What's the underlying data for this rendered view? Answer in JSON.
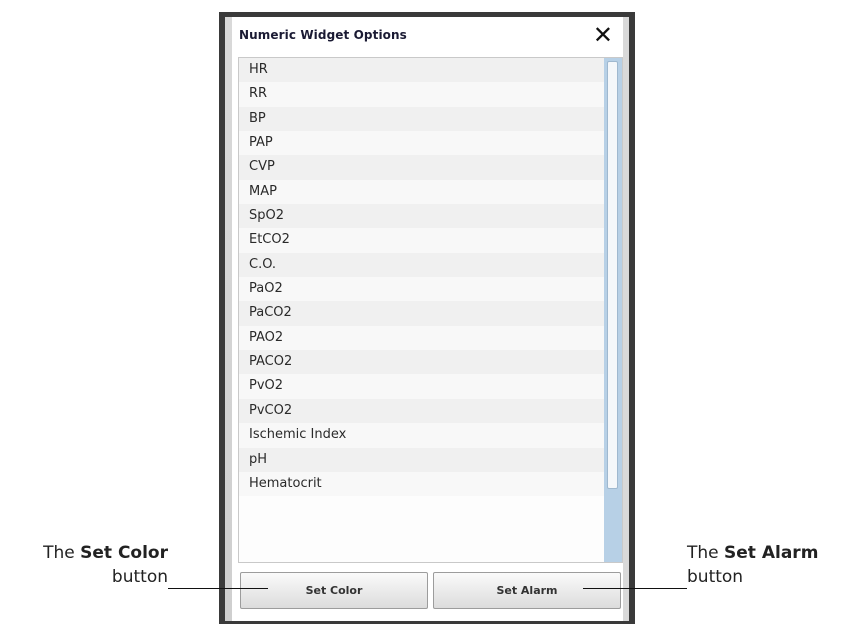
{
  "dialog": {
    "title": "Numeric Widget Options",
    "close_icon": "close-icon"
  },
  "list": {
    "items": [
      "HR",
      "RR",
      "BP",
      "PAP",
      "CVP",
      "MAP",
      "SpO2",
      "EtCO2",
      "C.O.",
      "PaO2",
      "PaCO2",
      "PAO2",
      "PACO2",
      "PvO2",
      "PvCO2",
      "Ischemic Index",
      "pH",
      "Hematocrit"
    ]
  },
  "buttons": {
    "set_color": "Set Color",
    "set_alarm": "Set Alarm"
  },
  "callouts": {
    "left": {
      "prefix": "The ",
      "bold": "Set Color",
      "suffix": "button"
    },
    "right": {
      "prefix": "The ",
      "bold": "Set Alarm",
      "suffix": "button"
    }
  },
  "colors": {
    "frame": "#3a3a3a",
    "scrollbar": "#b7d0e6"
  }
}
